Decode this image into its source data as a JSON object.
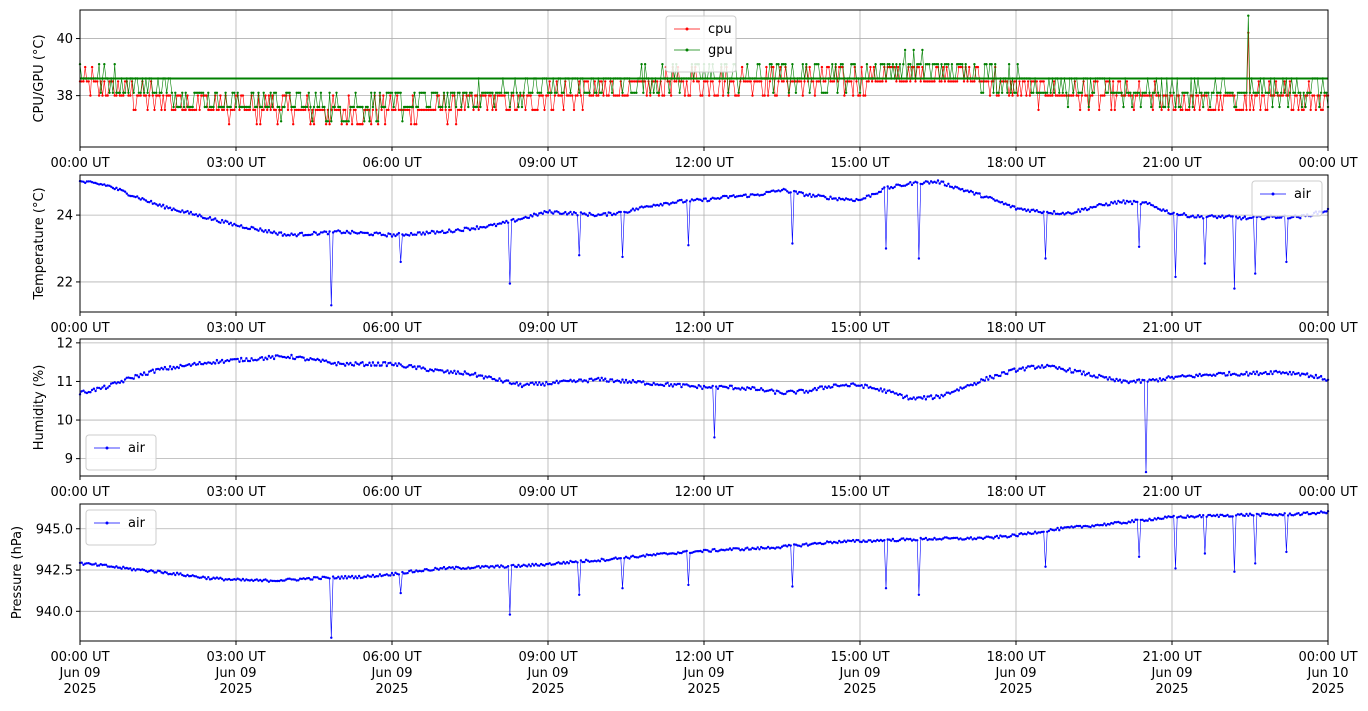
{
  "x_ticks": [
    "00:00 UT",
    "03:00 UT",
    "06:00 UT",
    "09:00 UT",
    "12:00 UT",
    "15:00 UT",
    "18:00 UT",
    "21:00 UT",
    "00:00 UT"
  ],
  "x_ticks_bottom": [
    [
      "00:00 UT",
      "Jun 09",
      "2025"
    ],
    [
      "03:00 UT",
      "Jun 09",
      "2025"
    ],
    [
      "06:00 UT",
      "Jun 09",
      "2025"
    ],
    [
      "09:00 UT",
      "Jun 09",
      "2025"
    ],
    [
      "12:00 UT",
      "Jun 09",
      "2025"
    ],
    [
      "15:00 UT",
      "Jun 09",
      "2025"
    ],
    [
      "18:00 UT",
      "Jun 09",
      "2025"
    ],
    [
      "21:00 UT",
      "Jun 09",
      "2025"
    ],
    [
      "00:00 UT",
      "Jun 10",
      "2025"
    ]
  ],
  "chart_data": [
    {
      "type": "line",
      "ylabel": "CPU/GPU (°C)",
      "ylim": [
        36.2,
        41.0
      ],
      "yticks": [
        38,
        40
      ],
      "ytick_labels": [
        "38",
        "40"
      ],
      "xlim": [
        "2025-06-09 00:00 UT",
        "2025-06-10 00:00 UT"
      ],
      "grid": true,
      "legend": "top-center",
      "x_hours": [
        0,
        1,
        2,
        3,
        4,
        5,
        6,
        7,
        8,
        9,
        10,
        11,
        12,
        13,
        14,
        15,
        16,
        17,
        18,
        19,
        20,
        21,
        22,
        23,
        24
      ],
      "series": [
        {
          "name": "cpu",
          "color": "#ff0000",
          "values": [
            38.6,
            38.0,
            37.8,
            37.6,
            37.5,
            37.4,
            37.5,
            37.6,
            37.8,
            38.0,
            38.1,
            38.3,
            38.5,
            38.5,
            38.5,
            38.5,
            38.7,
            38.7,
            38.3,
            38.0,
            38.0,
            37.8,
            37.8,
            37.9,
            38.0
          ]
        },
        {
          "name": "gpu",
          "color": "#008000",
          "values": [
            38.6,
            38.3,
            38.0,
            37.7,
            37.6,
            37.5,
            37.6,
            37.7,
            38.0,
            38.2,
            38.3,
            38.5,
            38.6,
            38.6,
            38.6,
            38.6,
            38.9,
            38.8,
            38.4,
            38.1,
            38.1,
            38.0,
            38.0,
            38.0,
            38.1
          ]
        }
      ]
    },
    {
      "type": "line",
      "ylabel": "Temperature (°C)",
      "ylim": [
        21.1,
        25.2
      ],
      "yticks": [
        22,
        24
      ],
      "ytick_labels": [
        "22",
        "24"
      ],
      "xlim": [
        "2025-06-09 00:00 UT",
        "2025-06-10 00:00 UT"
      ],
      "grid": true,
      "legend": "top-right",
      "x_hours": [
        0,
        0.5,
        1,
        1.5,
        2,
        2.5,
        3,
        3.5,
        4,
        4.5,
        5,
        5.5,
        6,
        6.5,
        7,
        7.5,
        8,
        8.5,
        9,
        9.5,
        10,
        10.5,
        11,
        11.5,
        12,
        12.5,
        13,
        13.5,
        14,
        14.5,
        15,
        15.5,
        16,
        16.5,
        17,
        17.5,
        18,
        18.5,
        19,
        19.5,
        20,
        20.5,
        21,
        21.5,
        22,
        22.5,
        23,
        23.5,
        24
      ],
      "series": [
        {
          "name": "air",
          "color": "#0000ff",
          "values": [
            25.0,
            24.9,
            24.6,
            24.3,
            24.1,
            23.9,
            23.7,
            23.55,
            23.4,
            23.45,
            23.5,
            23.45,
            23.4,
            23.45,
            23.5,
            23.6,
            23.7,
            23.9,
            24.1,
            24.05,
            24.0,
            24.1,
            24.3,
            24.4,
            24.45,
            24.55,
            24.6,
            24.75,
            24.6,
            24.5,
            24.45,
            24.8,
            24.95,
            25.0,
            24.75,
            24.5,
            24.2,
            24.1,
            24.05,
            24.25,
            24.4,
            24.35,
            24.05,
            23.95,
            23.95,
            23.9,
            23.95,
            23.95,
            24.15
          ]
        }
      ],
      "dips": [
        [
          4.83,
          21.3
        ],
        [
          6.17,
          22.6
        ],
        [
          8.25,
          21.95
        ],
        [
          9.6,
          22.8
        ],
        [
          10.45,
          22.75
        ],
        [
          11.7,
          23.1
        ],
        [
          13.7,
          23.15
        ],
        [
          15.5,
          23.0
        ],
        [
          16.15,
          22.7
        ],
        [
          18.55,
          22.7
        ],
        [
          20.35,
          23.05
        ],
        [
          21.05,
          22.15
        ],
        [
          21.65,
          22.55
        ],
        [
          22.2,
          21.8
        ],
        [
          22.6,
          22.25
        ],
        [
          23.2,
          22.6
        ]
      ]
    },
    {
      "type": "line",
      "ylabel": "Humidity (%)",
      "ylim": [
        8.55,
        12.1
      ],
      "yticks": [
        9,
        10,
        11,
        12
      ],
      "ytick_labels": [
        "9",
        "10",
        "11",
        "12"
      ],
      "xlim": [
        "2025-06-09 00:00 UT",
        "2025-06-10 00:00 UT"
      ],
      "grid": true,
      "legend": "bottom-left",
      "x_hours": [
        0,
        0.5,
        1,
        1.5,
        2,
        2.5,
        3,
        3.5,
        4,
        4.5,
        5,
        5.5,
        6,
        6.5,
        7,
        7.5,
        8,
        8.5,
        9,
        9.5,
        10,
        10.5,
        11,
        11.5,
        12,
        12.5,
        13,
        13.5,
        14,
        14.5,
        15,
        15.5,
        16,
        16.5,
        17,
        17.5,
        18,
        18.5,
        19,
        19.5,
        20,
        20.5,
        21,
        21.5,
        22,
        22.5,
        23,
        23.5,
        24
      ],
      "series": [
        {
          "name": "air",
          "color": "#0000ff",
          "values": [
            10.7,
            10.85,
            11.1,
            11.3,
            11.4,
            11.5,
            11.55,
            11.6,
            11.65,
            11.55,
            11.45,
            11.45,
            11.45,
            11.35,
            11.25,
            11.2,
            11.05,
            10.9,
            10.95,
            11.0,
            11.05,
            11.0,
            10.95,
            10.9,
            10.85,
            10.85,
            10.8,
            10.7,
            10.75,
            10.9,
            10.9,
            10.75,
            10.55,
            10.6,
            10.85,
            11.1,
            11.3,
            11.4,
            11.3,
            11.15,
            11.0,
            11.0,
            11.1,
            11.15,
            11.2,
            11.2,
            11.25,
            11.2,
            11.05
          ]
        }
      ],
      "dips": [
        [
          12.2,
          9.55
        ],
        [
          20.5,
          8.65
        ]
      ]
    },
    {
      "type": "line",
      "ylabel": "Pressure (hPa)",
      "ylim": [
        938.2,
        946.5
      ],
      "yticks": [
        940.0,
        942.5,
        945.0
      ],
      "ytick_labels": [
        "940.0",
        "942.5",
        "945.0"
      ],
      "xlim": [
        "2025-06-09 00:00 UT",
        "2025-06-10 00:00 UT"
      ],
      "grid": true,
      "legend": "top-left",
      "x_hours": [
        0,
        0.5,
        1,
        1.5,
        2,
        2.5,
        3,
        3.5,
        4,
        4.5,
        5,
        5.5,
        6,
        6.5,
        7,
        7.5,
        8,
        8.5,
        9,
        9.5,
        10,
        10.5,
        11,
        11.5,
        12,
        12.5,
        13,
        13.5,
        14,
        14.5,
        15,
        15.5,
        16,
        16.5,
        17,
        17.5,
        18,
        18.5,
        19,
        19.5,
        20,
        20.5,
        21,
        21.5,
        22,
        22.5,
        23,
        23.5,
        24
      ],
      "series": [
        {
          "name": "air",
          "color": "#0000ff",
          "values": [
            942.9,
            942.75,
            942.55,
            942.4,
            942.2,
            942.0,
            941.9,
            941.85,
            941.9,
            942.0,
            942.05,
            942.1,
            942.25,
            942.45,
            942.6,
            942.65,
            942.7,
            942.75,
            942.85,
            943.0,
            943.1,
            943.25,
            943.4,
            943.55,
            943.65,
            943.75,
            943.8,
            943.9,
            944.05,
            944.2,
            944.25,
            944.3,
            944.35,
            944.4,
            944.4,
            944.45,
            944.6,
            944.85,
            945.05,
            945.2,
            945.35,
            945.55,
            945.7,
            945.75,
            945.8,
            945.85,
            945.85,
            945.9,
            946.0
          ]
        }
      ],
      "dips": [
        [
          4.83,
          938.4
        ],
        [
          6.15,
          941.1
        ],
        [
          8.25,
          939.8
        ],
        [
          9.6,
          941.0
        ],
        [
          10.45,
          941.4
        ],
        [
          11.7,
          941.6
        ],
        [
          13.7,
          941.5
        ],
        [
          15.5,
          941.4
        ],
        [
          16.15,
          941.0
        ],
        [
          18.55,
          942.7
        ],
        [
          20.35,
          943.3
        ],
        [
          21.05,
          942.6
        ],
        [
          21.65,
          943.5
        ],
        [
          22.2,
          942.4
        ],
        [
          22.6,
          942.9
        ],
        [
          23.2,
          943.6
        ]
      ]
    }
  ]
}
